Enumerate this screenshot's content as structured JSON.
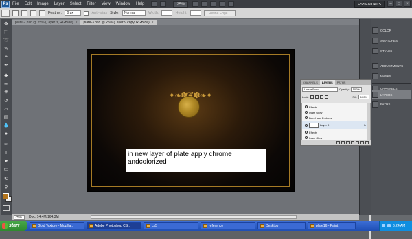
{
  "menubar": {
    "logo": "Ps",
    "items": [
      "File",
      "Edit",
      "Image",
      "Layer",
      "Select",
      "Filter",
      "View",
      "Window",
      "Help"
    ],
    "zoom": "25%",
    "workspace": "ESSENTIALS"
  },
  "options": {
    "feather_label": "Feather:",
    "feather_value": "0 px",
    "antialias_label": "Anti-alias",
    "style_label": "Style:",
    "style_value": "Normal",
    "width_label": "Width:",
    "height_label": "Height:",
    "refine_label": "Refine Edge..."
  },
  "tabs": [
    {
      "label": "plate-2.psd @ 25% (Layer 3, RGB/8#)",
      "close": "×"
    },
    {
      "label": "plate-3.psd @ 25% (Layer 9 copy, RGB/8#)",
      "close": "×"
    }
  ],
  "canvas": {
    "caption": "in new layer of plate apply chrome andcolorized",
    "ornament": "✦❧✽❦✽❧✦"
  },
  "statusbar": {
    "zoom": "25%",
    "doc": "Doc: 14.4M/164.3M"
  },
  "dock": {
    "items": [
      "COLOR",
      "SWATCHES",
      "STYLES",
      "ADJUSTMENTS",
      "MASKS",
      "CHANNELS",
      "LAYERS",
      "PATHS"
    ]
  },
  "layers_panel": {
    "tabs": [
      "CHANNELS",
      "LAYERS",
      "PATHS"
    ],
    "blend_mode": "Linear Burn",
    "opacity_label": "Opacity:",
    "opacity_value": "100%",
    "lock_label": "Lock:",
    "fill_label": "Fill:",
    "fill_value": "100%",
    "items": [
      "Effects",
      "Inner Glow",
      "Bevel and Emboss",
      "Layer 9",
      "Effects",
      "Inner Glow"
    ],
    "fx": "fx"
  },
  "taskbar": {
    "start": "start",
    "tasks": [
      "Gold Texture - Mozilla...",
      "Adobe Photoshop CS...",
      "cs5",
      "reference",
      "Desktop",
      "plate16 - Paint"
    ],
    "clock": "6:24 AM"
  }
}
